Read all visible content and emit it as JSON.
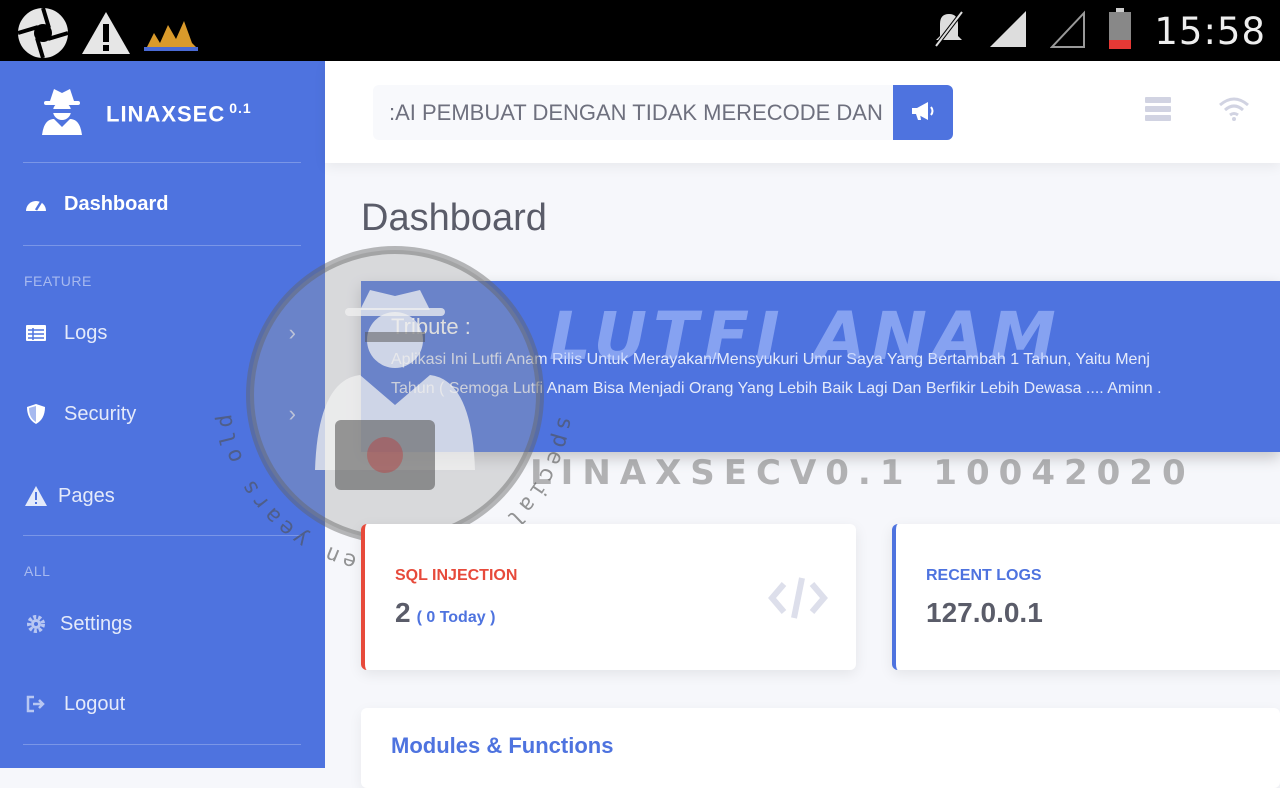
{
  "status_bar": {
    "time": "15:58",
    "icons": [
      "aperture-icon",
      "warning-icon",
      "app-icon",
      "mute-icon",
      "signal-icon",
      "signal-empty-icon",
      "battery-icon"
    ]
  },
  "sidebar": {
    "brand": {
      "name": "LINAXSEC",
      "version": "0.1",
      "icon": "user-secret-icon"
    },
    "items": [
      {
        "label": "Dashboard",
        "icon": "tachometer-icon",
        "active": true
      },
      {
        "section": "FEATURE"
      },
      {
        "label": "Logs",
        "icon": "table-icon",
        "has_submenu": true
      },
      {
        "label": "Security",
        "icon": "shield-icon",
        "has_submenu": true
      },
      {
        "label": "Pages",
        "icon": "warning-icon"
      },
      {
        "section": "ALL"
      },
      {
        "label": "Settings",
        "icon": "gear-icon"
      },
      {
        "label": "Logout",
        "icon": "sign-out-icon"
      }
    ]
  },
  "topbar": {
    "marquee_text": ":AI PEMBUAT DENGAN TIDAK MERECODE DAN",
    "announce_icon": "bullhorn-icon",
    "right_icons": [
      "server-icon",
      "wifi-icon"
    ]
  },
  "main": {
    "page_title": "Dashboard",
    "tribute": {
      "title": "Tribute :",
      "line1": "Aplikasi Ini Lutfi Anam Rilis Untuk Merayakan/Mensyukuri Umur Saya Yang Bertambah 1 Tahun, Yaitu Menj",
      "line2": "Tahun ( Semoga Lutfi Anam Bisa Menjadi Orang Yang Lebih Baik Lagi Dan Berfikir Lebih Dewasa .... Aminn ."
    },
    "watermark": {
      "name": "LUTFI ANAM",
      "version_line": "LINAXSECV0.1 10042020",
      "ring_text": "special seven teen years old"
    },
    "cards": [
      {
        "label": "SQL INJECTION",
        "value": "2",
        "sub": "( 0 Today )",
        "icon": "code-icon",
        "accent": "#e74a3b"
      },
      {
        "label": "RECENT LOGS",
        "value": "127.0.0.1",
        "accent": "#4e73df"
      }
    ],
    "modules_title": "Modules & Functions"
  },
  "colors": {
    "primary": "#4e73df",
    "danger": "#e74a3b",
    "text": "#5a5c69"
  }
}
